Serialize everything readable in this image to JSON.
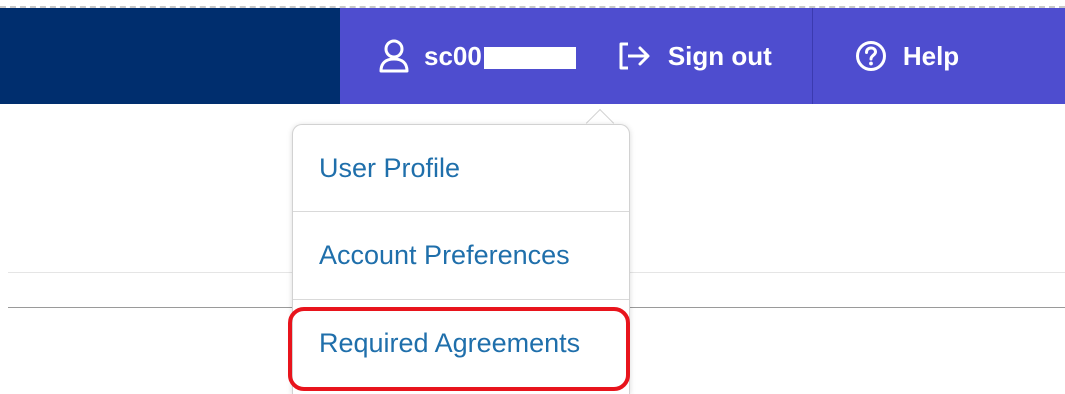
{
  "header": {
    "user": {
      "icon": "user-icon",
      "label": "sc00",
      "redacted": true
    },
    "sign_out": {
      "icon": "sign-out-icon",
      "label": "Sign out"
    },
    "help": {
      "icon": "help-circle-icon",
      "label": "Help"
    },
    "colors": {
      "left_bar": "#002e6e",
      "right_bar": "#4e4dcf"
    }
  },
  "user_menu": {
    "items": [
      {
        "label": "User Profile"
      },
      {
        "label": "Account Preferences"
      },
      {
        "label": "Required Agreements",
        "highlighted": true
      }
    ],
    "link_color": "#1f6fab",
    "highlight_color": "#e8141c"
  }
}
